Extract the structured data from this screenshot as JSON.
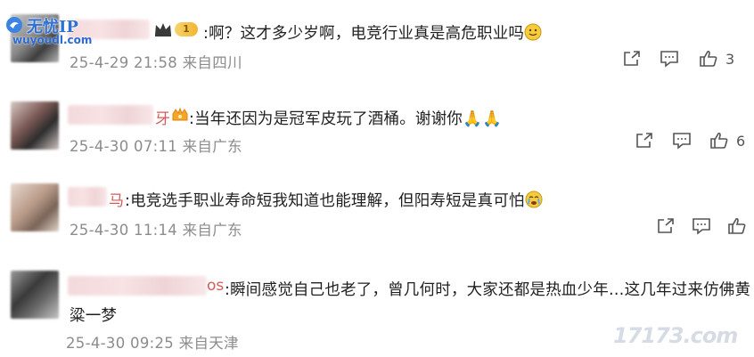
{
  "watermark_top_left": {
    "title": "无忧IP",
    "url": "wuyoudl.com"
  },
  "watermark_bottom_right": "17173.com",
  "comments": [
    {
      "name_suffix": "",
      "text": ":啊？这才多少岁啊，电竞行业真是高危职业吗",
      "date": "25-4-29 21:58 来自四川",
      "badge_level": "1",
      "likes": "3"
    },
    {
      "name_suffix": "牙",
      "text": ":当年还因为是冠军皮玩了酒桶。谢谢你🙏🙏",
      "date": "25-4-30 07:11 来自广东",
      "likes": "6"
    },
    {
      "name_suffix": "马",
      "text": ":电竞选手职业寿命短我知道也能理解，但阳寿短是真可怕",
      "date": "25-4-30 11:14 来自广东",
      "likes": ""
    },
    {
      "name_suffix": "os",
      "text_line1": ":瞬间感觉自己也老了，曾几何时，大家还都是热血少年…这几年过来仿佛黄",
      "text_line2": "粱一梦",
      "date": "25-4-30 09:25 来自天津",
      "likes": ""
    }
  ],
  "icons": [
    "share-icon",
    "comment-icon",
    "like-icon",
    "crown-icon",
    "fan-badge-icon",
    "smile-emoji",
    "cry-emoji"
  ]
}
